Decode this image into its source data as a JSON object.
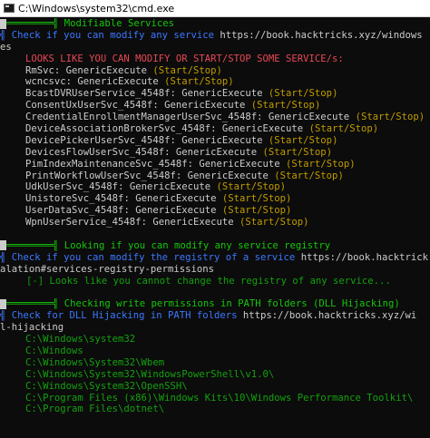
{
  "window": {
    "title": "C:\\Windows\\system32\\cmd.exe"
  },
  "section_services": {
    "header": "Modifiable Services",
    "check_prefix": "Check if you can modify any service",
    "url_line1": "https://book.hacktricks.xyz/windows",
    "url_line2": "es",
    "looks_like": "LOOKS LIKE YOU CAN MODIFY OR START/STOP SOME SERVICE/s:",
    "services": [
      {
        "name": "RmSvc",
        "perm": "GenericExecute",
        "action": "(Start/Stop)"
      },
      {
        "name": "wcncsvc",
        "perm": "GenericExecute",
        "action": "(Start/Stop)"
      },
      {
        "name": "BcastDVRUserService_4548f",
        "perm": "GenericExecute",
        "action": "(Start/Stop)"
      },
      {
        "name": "ConsentUxUserSvc_4548f",
        "perm": "GenericExecute",
        "action": "(Start/Stop)"
      },
      {
        "name": "CredentialEnrollmentManagerUserSvc_4548f",
        "perm": "GenericExecute",
        "action": "(Start/Stop)"
      },
      {
        "name": "DeviceAssociationBrokerSvc_4548f",
        "perm": "GenericExecute",
        "action": "(Start/Stop)"
      },
      {
        "name": "DevicePickerUserSvc_4548f",
        "perm": "GenericExecute",
        "action": "(Start/Stop)"
      },
      {
        "name": "DevicesFlowUserSvc_4548f",
        "perm": "GenericExecute",
        "action": "(Start/Stop)"
      },
      {
        "name": "PimIndexMaintenanceSvc_4548f",
        "perm": "GenericExecute",
        "action": "(Start/Stop)"
      },
      {
        "name": "PrintWorkflowUserSvc_4548f",
        "perm": "GenericExecute",
        "action": "(Start/Stop)"
      },
      {
        "name": "UdkUserSvc_4548f",
        "perm": "GenericExecute",
        "action": "(Start/Stop)"
      },
      {
        "name": "UnistoreSvc_4548f",
        "perm": "GenericExecute",
        "action": "(Start/Stop)"
      },
      {
        "name": "UserDataSvc_4548f",
        "perm": "GenericExecute",
        "action": "(Start/Stop)"
      },
      {
        "name": "WpnUserService_4548f",
        "perm": "GenericExecute",
        "action": "(Start/Stop)"
      }
    ]
  },
  "section_registry": {
    "header": "Looking if you can modify any service registry",
    "check_prefix": "Check if you can modify the registry of a service",
    "url_line1": "https://book.hacktrick",
    "url_line2": "alation#services-registry-permissions",
    "result": "[-] Looks like you cannot change the registry of any service..."
  },
  "section_path": {
    "header": "Checking write permissions in PATH folders (DLL Hijacking)",
    "check_prefix": "Check for DLL Hijacking in PATH folders",
    "url_line1": "https://book.hacktricks.xyz/wi",
    "url_line2": "l-hijacking",
    "folders": [
      "C:\\Windows\\system32",
      "C:\\Windows",
      "C:\\Windows\\System32\\Wbem",
      "C:\\Windows\\System32\\WindowsPowerShell\\v1.0\\",
      "C:\\Windows\\System32\\OpenSSH\\",
      "C:\\Program Files (x86)\\Windows Kits\\10\\Windows Performance Toolkit\\",
      "C:\\Program Files\\dotnet\\"
    ]
  },
  "colors": {
    "background": "#0c0c0c",
    "header_green": "#16c60c",
    "check_blue": "#3b78ff",
    "warning_red": "#e74856",
    "action_yellow": "#c19c00",
    "path_green": "#13a10e",
    "text_gray": "#cccccc"
  }
}
